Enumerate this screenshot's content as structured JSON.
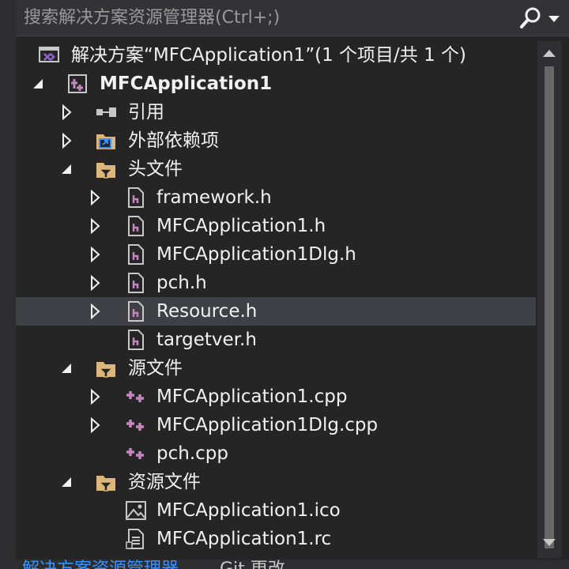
{
  "search": {
    "placeholder": "搜索解决方案资源管理器(Ctrl+;)",
    "icon": "search-icon",
    "dropdown_icon": "chevron-down-icon"
  },
  "colors": {
    "background": "#252526",
    "text": "#f1f1f1",
    "selected_row": "#3f3f46",
    "folder": "#dcb67a",
    "file_icon_accent": "#c586c0",
    "link": "#3794ff"
  },
  "tree": {
    "solution": {
      "label": "解决方案“MFCApplication1”(1 个项目/共 1 个)",
      "icon": "solution-icon"
    },
    "project": {
      "label": "MFCApplication1",
      "icon": "project-icon",
      "expanded": true
    },
    "references": {
      "label": "引用",
      "icon": "references-icon",
      "expanded": false
    },
    "external_deps": {
      "label": "外部依赖项",
      "icon": "external-dependencies-icon",
      "expanded": false
    },
    "header_files": {
      "label": "头文件",
      "icon": "folder-filter-icon",
      "expanded": true,
      "items": [
        {
          "label": "framework.h",
          "icon": "header-file-icon",
          "expandable": true
        },
        {
          "label": "MFCApplication1.h",
          "icon": "header-file-icon",
          "expandable": true
        },
        {
          "label": "MFCApplication1Dlg.h",
          "icon": "header-file-icon",
          "expandable": true
        },
        {
          "label": "pch.h",
          "icon": "header-file-icon",
          "expandable": true
        },
        {
          "label": "Resource.h",
          "icon": "header-file-icon",
          "expandable": true,
          "selected": true
        },
        {
          "label": "targetver.h",
          "icon": "header-file-icon",
          "expandable": false
        }
      ]
    },
    "source_files": {
      "label": "源文件",
      "icon": "folder-filter-icon",
      "expanded": true,
      "items": [
        {
          "label": "MFCApplication1.cpp",
          "icon": "cpp-file-icon",
          "expandable": true
        },
        {
          "label": "MFCApplication1Dlg.cpp",
          "icon": "cpp-file-icon",
          "expandable": true
        },
        {
          "label": "pch.cpp",
          "icon": "cpp-file-icon",
          "expandable": false
        }
      ]
    },
    "resource_files": {
      "label": "资源文件",
      "icon": "folder-filter-icon",
      "expanded": true,
      "items": [
        {
          "label": "MFCApplication1.ico",
          "icon": "image-file-icon",
          "expandable": false
        },
        {
          "label": "MFCApplication1.rc",
          "icon": "resource-script-icon",
          "expandable": false
        }
      ]
    }
  },
  "bottom_tabs": [
    {
      "label": "解决方案资源管理器",
      "active": true
    },
    {
      "label": "Git 更改",
      "active": false
    }
  ]
}
